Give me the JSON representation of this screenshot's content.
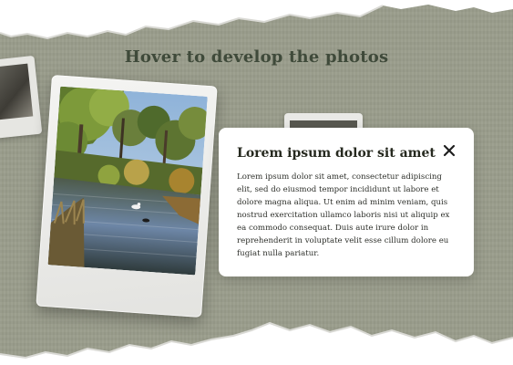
{
  "page": {
    "heading": "Hover to develop the photos"
  },
  "modal": {
    "title": "Lorem ipsum dolor sit amet",
    "close_icon": "close-icon",
    "body": "Lorem ipsum dolor sit amet, consectetur adipiscing elit, sed do eiusmod tempor incididunt ut labore et dolore magna aliqua. Ut enim ad minim veniam, quis nostrud exercitation ullamco laboris nisi ut aliquip ex ea commodo consequat. Duis aute irure dolor in reprehenderit in voluptate velit esse cillum dolore eu fugiat nulla pariatur."
  },
  "colors": {
    "background": "#9a9d8c",
    "heading": "#3f4a3a",
    "card": "#ffffff"
  }
}
